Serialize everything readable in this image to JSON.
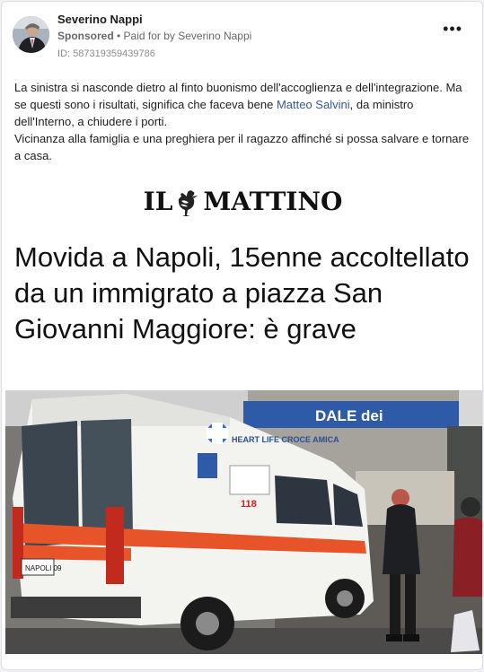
{
  "post": {
    "author": "Severino Nappi",
    "sponsored": "Sponsored",
    "separator": " • ",
    "paid_prefix": "Paid for by ",
    "paid_by": "Severino Nappi",
    "ad_id": "ID: 587319359439786",
    "more_label": "•••"
  },
  "body": {
    "part1": "La sinistra si nasconde dietro al finto buonismo dell'accoglienza e dell'integrazione. Ma se questi sono i risultati, significa che faceva bene ",
    "link": "Matteo Salvini",
    "part2": ", da ministro dell'Interno, a chiudere i porti.",
    "line2": "Vicinanza alla famiglia e una preghiera per il ragazzo affinché si possa salvare e tornare a casa."
  },
  "article": {
    "logo_left": "IL",
    "logo_right": "MATTINO",
    "headline": "Movida a Napoli, 15enne accoltellato da un immigrato a piazza San Giovanni Maggiore: è grave"
  },
  "photo": {
    "ambulance_text": "HEART LIFE CROCE AMICA",
    "number_118": "118",
    "hospital_sign": "DALE dei",
    "plate": "NAPOLI 09"
  },
  "colors": {
    "accent_link": "#385898",
    "ambulance_stripe": "#e8542a",
    "background": "#f0f2f5"
  }
}
